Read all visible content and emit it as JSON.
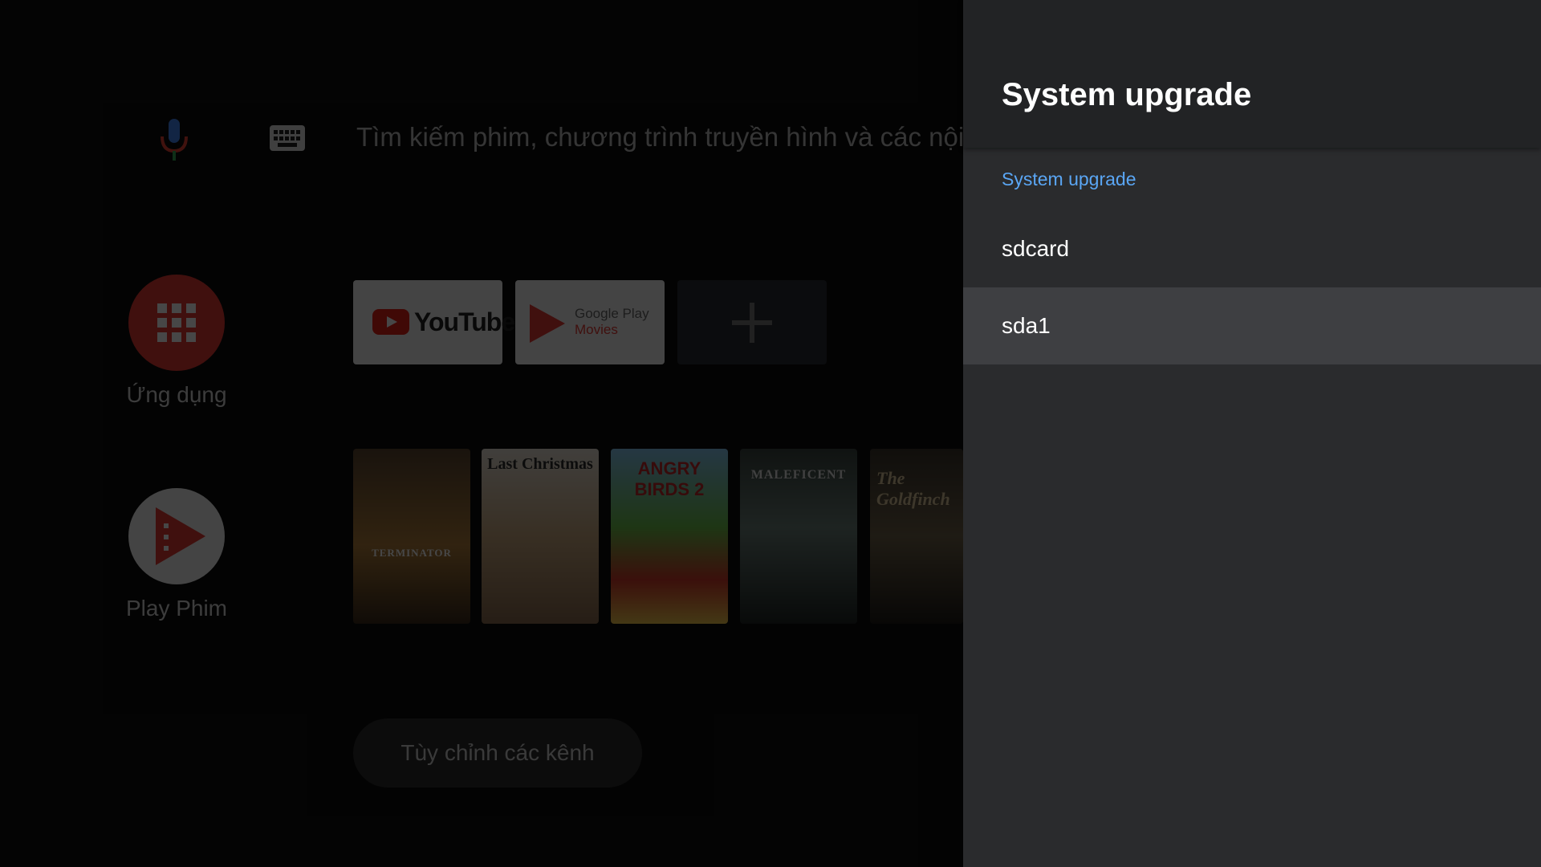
{
  "launcher": {
    "search_placeholder": "Tìm kiếm phim, chương trình truyền hình và các nội dung khác",
    "side_apps": [
      {
        "label": "Ứng dụng",
        "icon": "apps-grid-icon"
      },
      {
        "label": "Play Phim",
        "icon": "play-movies-icon"
      }
    ],
    "app_tiles": [
      {
        "name": "YouTube",
        "logo_text": "YouTube"
      },
      {
        "name": "Google Play Movies",
        "logo_line1": "Google Play",
        "logo_line2": "Movies"
      },
      {
        "name": "Add app",
        "icon": "plus-icon"
      }
    ],
    "posters": [
      {
        "title": "TERMINATOR"
      },
      {
        "title": "Last Christmas"
      },
      {
        "title": "ANGRY BIRDS 2"
      },
      {
        "title": "MALEFICENT"
      },
      {
        "title": "The Goldfinch"
      }
    ],
    "customize_channels": "Tùy chỉnh các kênh"
  },
  "panel": {
    "title": "System upgrade",
    "section_label": "System upgrade",
    "items": [
      {
        "label": "sdcard",
        "focused": false
      },
      {
        "label": "sda1",
        "focused": true
      }
    ]
  },
  "colors": {
    "panel_background": "#2a2b2d",
    "panel_header": "#222325",
    "accent_blue": "#5aa6f4",
    "focused_item": "#3e3f42",
    "apps_red": "#e53935"
  }
}
